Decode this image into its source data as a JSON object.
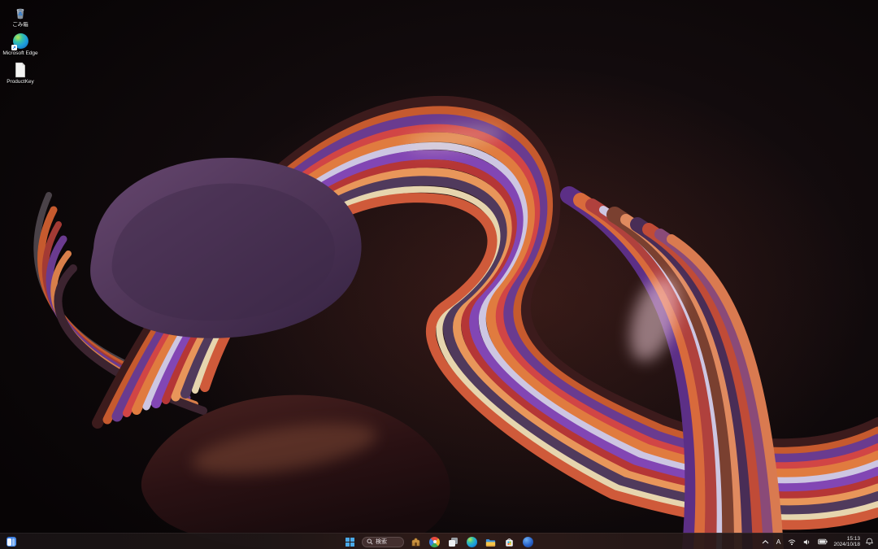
{
  "desktop": {
    "icons": [
      {
        "name": "recycle-bin",
        "label": "ごみ箱"
      },
      {
        "name": "microsoft-edge",
        "label": "Microsoft Edge"
      },
      {
        "name": "productkey",
        "label": "ProductKey"
      }
    ]
  },
  "taskbar": {
    "search": {
      "placeholder": "検索"
    },
    "pinned_apps": [
      "castle-app",
      "photos-app",
      "task-view",
      "microsoft-edge",
      "file-explorer",
      "microsoft-store",
      "outlook"
    ],
    "tray": {
      "ime_mode": "A",
      "icons": [
        "hidden-icons-chevron",
        "wifi",
        "volume",
        "battery",
        "notification-bell"
      ],
      "time": "15:13",
      "date": "2024/10/18"
    }
  },
  "wallpaper": {
    "style": "Windows 11 abstract flowing ribbons on dark background",
    "palette": [
      "#0b0709",
      "#5f4168",
      "#8246b4",
      "#cdc6e2",
      "#c65a2e",
      "#e07b3f",
      "#d14545",
      "#3c1b1c",
      "#e6d5ae",
      "#2a1012"
    ]
  }
}
